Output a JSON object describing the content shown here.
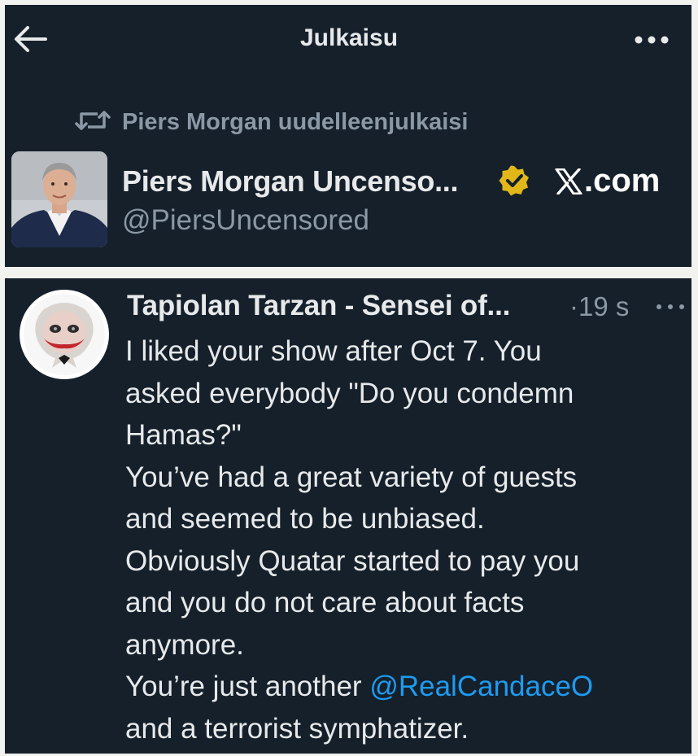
{
  "header": {
    "title": "Julkaisu",
    "back_icon": "back-arrow-icon",
    "more_icon": "more-horizontal-icon"
  },
  "repost": {
    "icon": "repost-icon",
    "label": "Piers Morgan uudelleenjulkaisi"
  },
  "post": {
    "author_name": "Piers Morgan Uncenso...",
    "handle": "@PiersUncensored",
    "verified_icon": "verified-badge-icon",
    "verified_color": "#e2b719",
    "watermark": "com"
  },
  "reply": {
    "author_name": "Tapiolan Tarzan - Sensei of...",
    "time": "19 s",
    "lines": [
      "I liked your show after Oct 7. You",
      "asked everybody \"Do you condemn",
      "Hamas?\"",
      "You’ve had a great variety of guests",
      "and seemed to be unbiased.",
      "Obviously Quatar started to pay you",
      "and you do not care about facts",
      "anymore."
    ],
    "line9_prefix": "You’re just another ",
    "mention": "@RealCandaceO",
    "line10": "and a terrorist symphatizer."
  },
  "colors": {
    "background": "#15202b",
    "text": "#e7e9ea",
    "secondary": "#8b98a5",
    "link": "#1d9bf0"
  }
}
